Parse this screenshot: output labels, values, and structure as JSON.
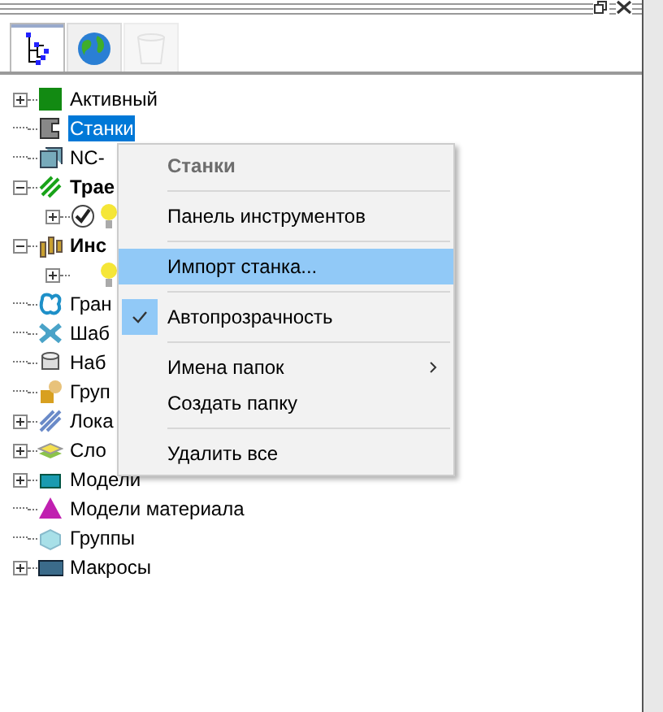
{
  "tabs": [
    {
      "kind": "tree",
      "selected": true,
      "disabled": false
    },
    {
      "kind": "globe",
      "selected": false,
      "disabled": false
    },
    {
      "kind": "bin",
      "selected": false,
      "disabled": true
    }
  ],
  "tree": [
    {
      "label": "Активный",
      "expanded": false,
      "selected": false
    },
    {
      "label": "Станки",
      "selected": true
    },
    {
      "label": "NC-",
      "selected": false
    },
    {
      "label": "Трае",
      "expanded": true,
      "bold": true,
      "selected": false,
      "children": [
        {
          "expanded": false
        }
      ]
    },
    {
      "label": "Инс",
      "expanded": true,
      "bold": true,
      "selected": false,
      "children": [
        {
          "expanded": false
        }
      ]
    },
    {
      "label": "Гран",
      "selected": false
    },
    {
      "label": "Шаб",
      "selected": false
    },
    {
      "label": "Наб",
      "selected": false
    },
    {
      "label": "Груп",
      "selected": false
    },
    {
      "label": "Лока",
      "expanded": false,
      "selected": false
    },
    {
      "label": "Сло",
      "expanded": false,
      "selected": false
    },
    {
      "label": "Модели",
      "expanded": false,
      "selected": false
    },
    {
      "label": "Модели материала",
      "selected": false
    },
    {
      "label": "Группы",
      "selected": false
    },
    {
      "label": "Макросы",
      "expanded": false,
      "selected": false
    }
  ],
  "context_menu": [
    {
      "kind": "header",
      "label": "Станки"
    },
    {
      "kind": "separator"
    },
    {
      "kind": "item",
      "label": "Панель инструментов",
      "selected": false,
      "checked": false
    },
    {
      "kind": "separator"
    },
    {
      "kind": "item",
      "label": "Импорт станка...",
      "selected": true,
      "checked": false
    },
    {
      "kind": "separator"
    },
    {
      "kind": "item",
      "label": "Автопрозрачность",
      "selected": false,
      "checked": true
    },
    {
      "kind": "separator"
    },
    {
      "kind": "item",
      "label": "Имена папок",
      "selected": false,
      "checked": false,
      "submenu": true
    },
    {
      "kind": "item",
      "label": "Создать папку",
      "selected": false,
      "checked": false
    },
    {
      "kind": "separator"
    },
    {
      "kind": "item",
      "label": "Удалить все",
      "selected": false,
      "checked": false
    }
  ]
}
